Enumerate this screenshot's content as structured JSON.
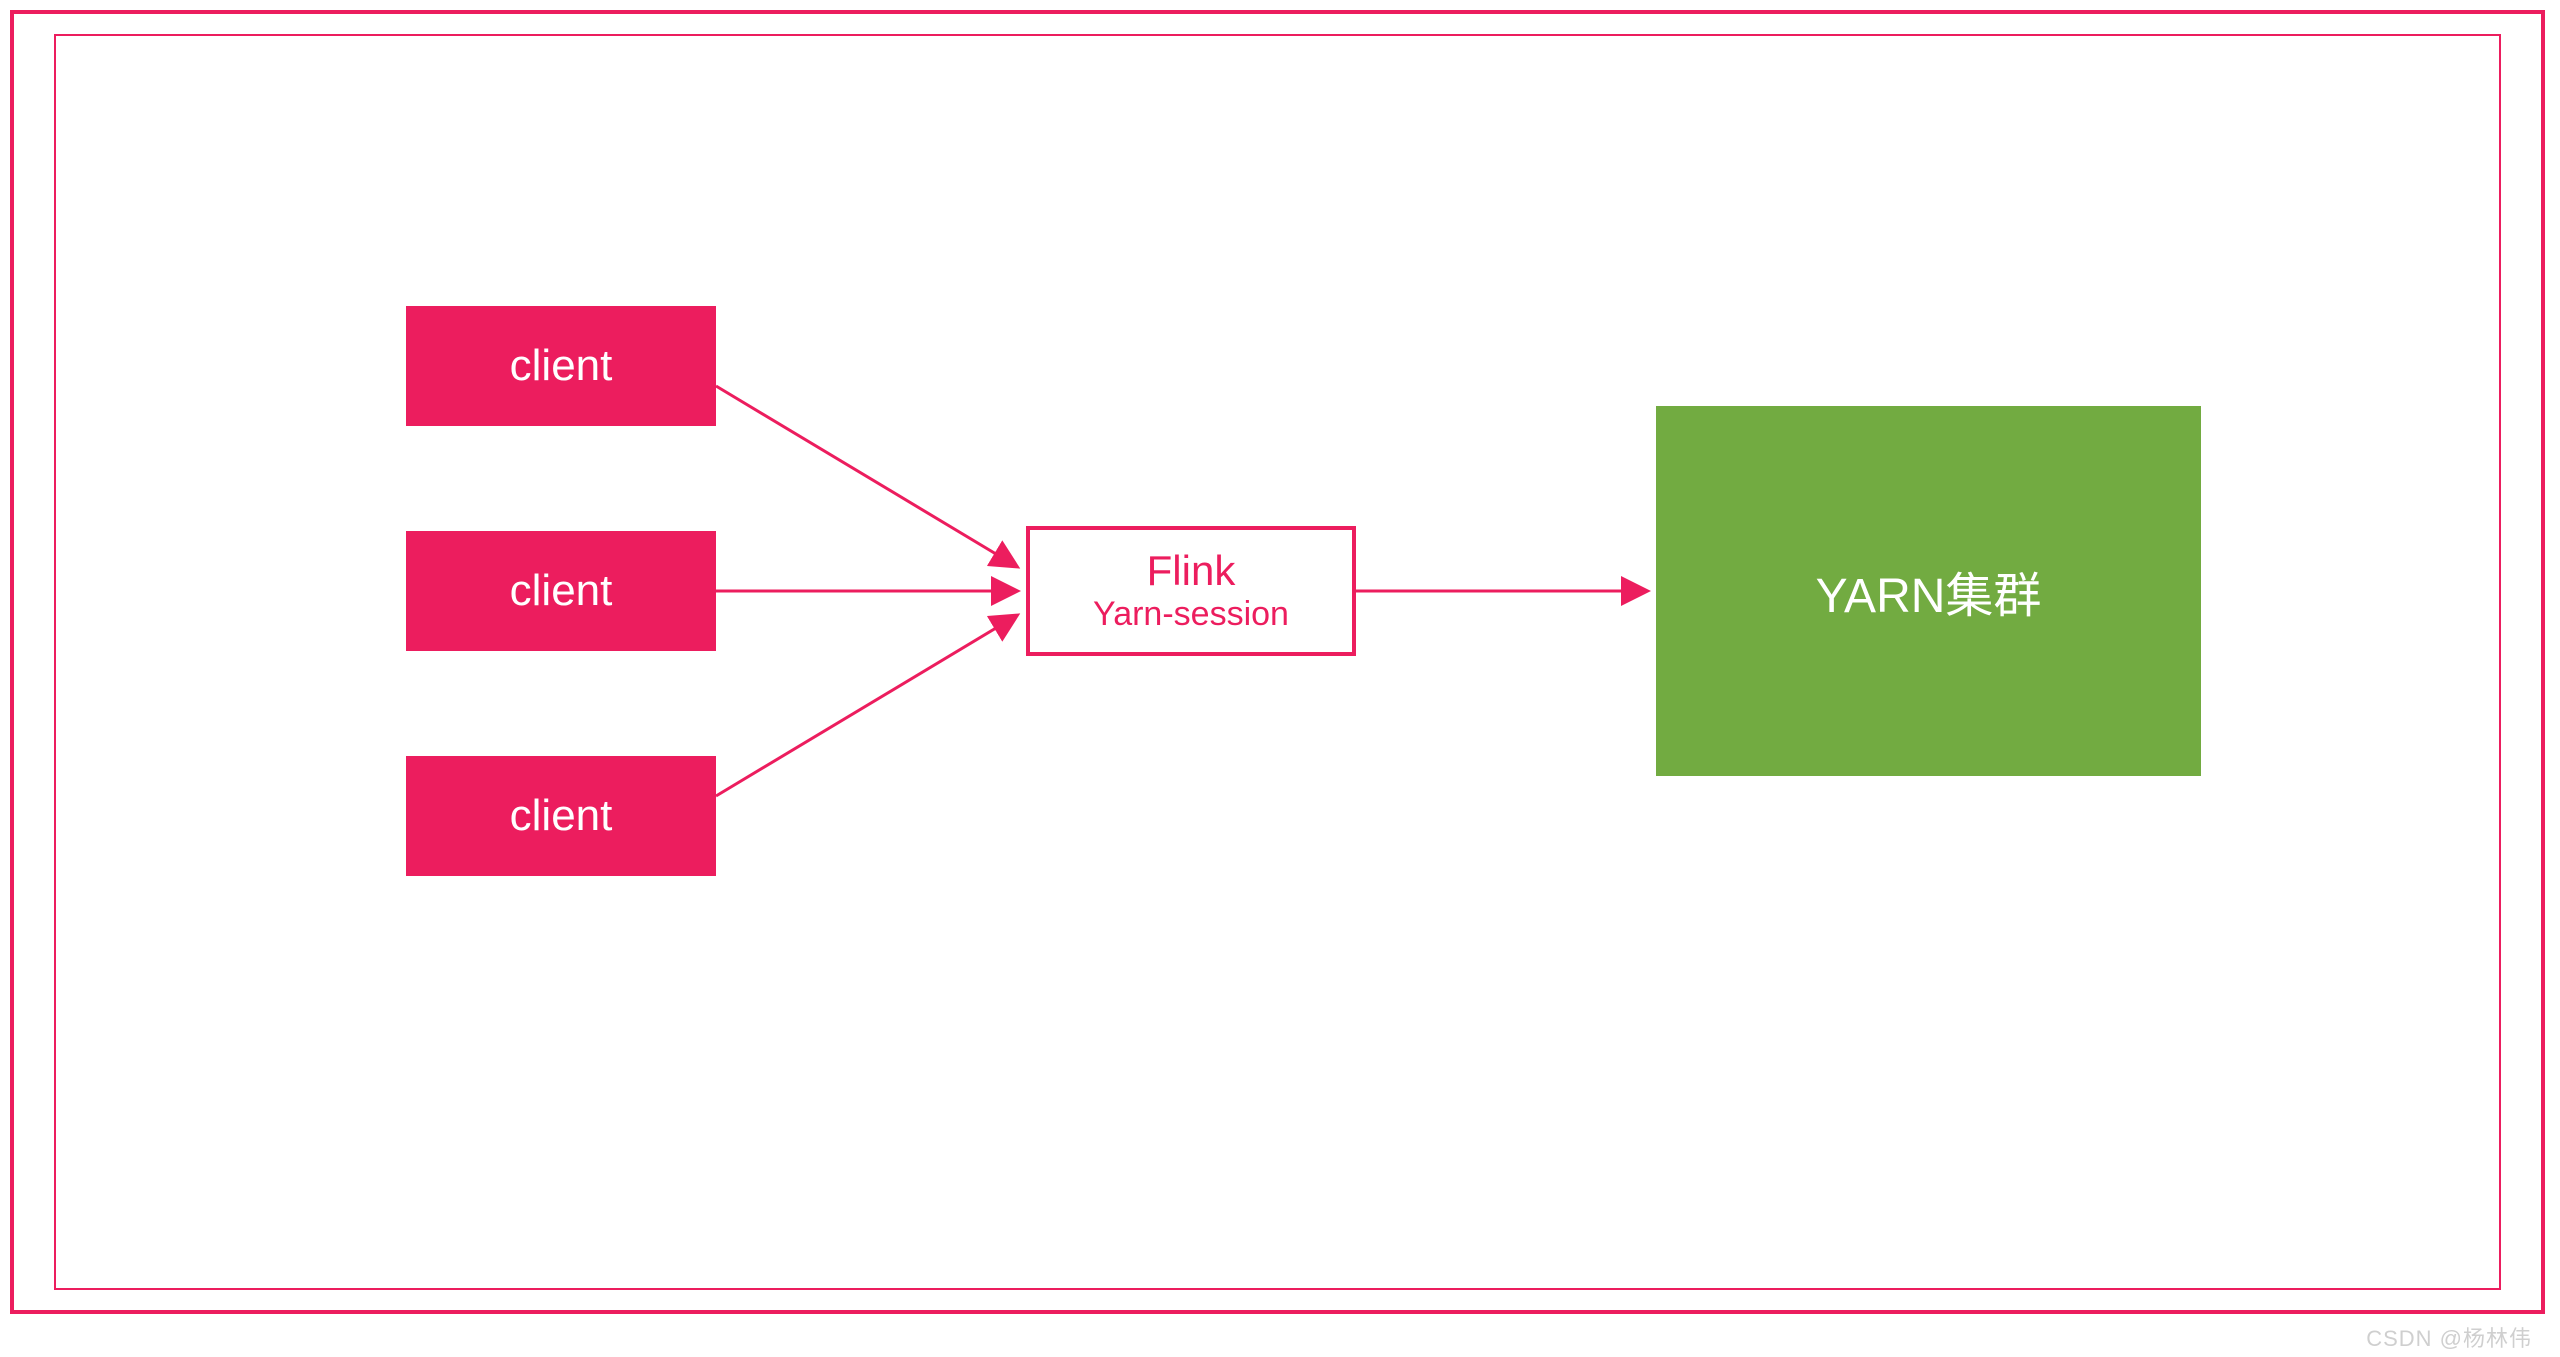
{
  "nodes": {
    "client1": "client",
    "client2": "client",
    "client3": "client",
    "flink_title": "Flink",
    "flink_sub": "Yarn-session",
    "yarn": "YARN集群"
  },
  "watermark": "CSDN @杨林伟",
  "colors": {
    "accent": "#ec1d5e",
    "yarn_bg": "#72ab41"
  },
  "chart_data": {
    "type": "diagram",
    "title": "",
    "nodes": [
      {
        "id": "client1",
        "label": "client",
        "group": "client"
      },
      {
        "id": "client2",
        "label": "client",
        "group": "client"
      },
      {
        "id": "client3",
        "label": "client",
        "group": "client"
      },
      {
        "id": "flink",
        "label": "Flink Yarn-session",
        "group": "flink"
      },
      {
        "id": "yarn",
        "label": "YARN集群",
        "group": "yarn"
      }
    ],
    "edges": [
      {
        "from": "client1",
        "to": "flink"
      },
      {
        "from": "client2",
        "to": "flink"
      },
      {
        "from": "client3",
        "to": "flink"
      },
      {
        "from": "flink",
        "to": "yarn"
      }
    ]
  }
}
